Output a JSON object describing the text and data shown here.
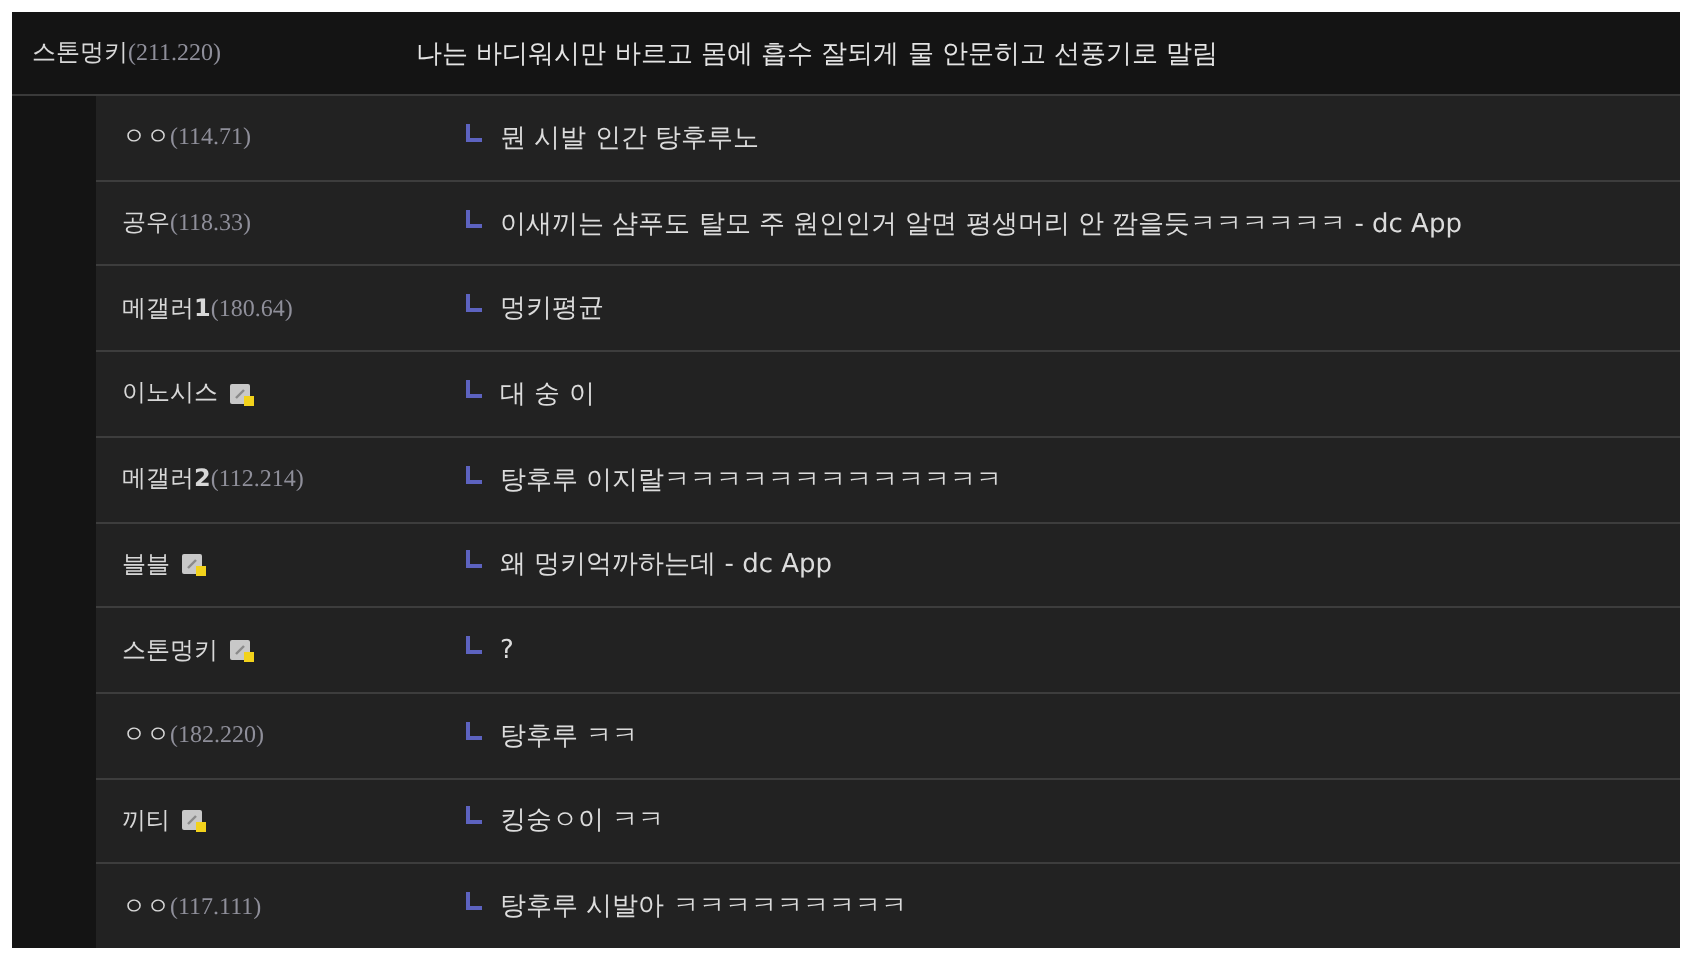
{
  "comment": {
    "author": {
      "name": "스톤멍키",
      "ip": "(211.220)"
    },
    "text": "나는 바디워시만 바르고 몸에 흡수 잘되게 물 안문히고 선풍기로 말림"
  },
  "replies": [
    {
      "name": "ㅇㅇ",
      "ip": "(114.71)",
      "fixed": false,
      "text": "뭔 시발 인간 탕후루노"
    },
    {
      "name": "공우",
      "ip": "(118.33)",
      "fixed": false,
      "text": "이새끼는 샴푸도 탈모 주 원인인거 알면 평생머리 안 깜을듯ㅋㅋㅋㅋㅋㅋ - dc App"
    },
    {
      "name": "메갤러**1**",
      "ip": "(180.64)",
      "fixed": false,
      "text": "멍키평균"
    },
    {
      "name": "이노시스",
      "fixed": true,
      "text": "대 숭 이"
    },
    {
      "name": "메갤러**2**",
      "ip": "(112.214)",
      "fixed": false,
      "text": "탕후루 이지랄ㅋㅋㅋㅋㅋㅋㅋㅋㅋㅋㅋㅋㅋ"
    },
    {
      "name": "블블",
      "fixed": true,
      "text": "왜 멍키억까하는데 - dc App"
    },
    {
      "name": "스톤멍키",
      "fixed": true,
      "text": "?"
    },
    {
      "name": "ㅇㅇ",
      "ip": "(182.220)",
      "fixed": false,
      "text": "탕후루 ㅋㅋ"
    },
    {
      "name": "끼티",
      "fixed": true,
      "text": "킹숭ㅇ이 ㅋㅋ"
    },
    {
      "name": "ㅇㅇ",
      "ip": "(117.111)",
      "fixed": false,
      "text": "탕후루 시발아 ㅋㅋㅋㅋㅋㅋㅋㅋㅋ"
    }
  ]
}
